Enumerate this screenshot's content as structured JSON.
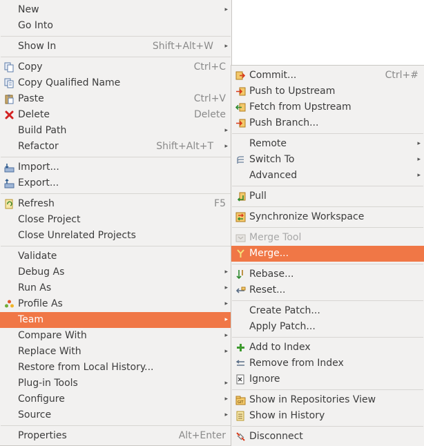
{
  "main_menu": {
    "items": [
      {
        "label": "New",
        "accel": "",
        "submenu": true,
        "icon": ""
      },
      {
        "label": "Go Into",
        "accel": "",
        "submenu": false,
        "icon": ""
      },
      {
        "label": "Show In",
        "accel": "Shift+Alt+W",
        "submenu": true,
        "icon": ""
      },
      {
        "label": "Copy",
        "accel": "Ctrl+C",
        "submenu": false,
        "icon": "copy-icon"
      },
      {
        "label": "Copy Qualified Name",
        "accel": "",
        "submenu": false,
        "icon": "copy-qualified-name-icon"
      },
      {
        "label": "Paste",
        "accel": "Ctrl+V",
        "submenu": false,
        "icon": "paste-icon"
      },
      {
        "label": "Delete",
        "accel": "Delete",
        "submenu": false,
        "icon": "delete-icon"
      },
      {
        "label": "Build Path",
        "accel": "",
        "submenu": true,
        "icon": ""
      },
      {
        "label": "Refactor",
        "accel": "Shift+Alt+T",
        "submenu": true,
        "icon": ""
      },
      {
        "label": "Import...",
        "accel": "",
        "submenu": false,
        "icon": "import-icon"
      },
      {
        "label": "Export...",
        "accel": "",
        "submenu": false,
        "icon": "export-icon"
      },
      {
        "label": "Refresh",
        "accel": "F5",
        "submenu": false,
        "icon": "refresh-icon"
      },
      {
        "label": "Close Project",
        "accel": "",
        "submenu": false,
        "icon": ""
      },
      {
        "label": "Close Unrelated Projects",
        "accel": "",
        "submenu": false,
        "icon": ""
      },
      {
        "label": "Validate",
        "accel": "",
        "submenu": false,
        "icon": ""
      },
      {
        "label": "Debug As",
        "accel": "",
        "submenu": true,
        "icon": ""
      },
      {
        "label": "Run As",
        "accel": "",
        "submenu": true,
        "icon": ""
      },
      {
        "label": "Profile As",
        "accel": "",
        "submenu": true,
        "icon": "profile-icon"
      },
      {
        "label": "Team",
        "accel": "",
        "submenu": true,
        "icon": ""
      },
      {
        "label": "Compare With",
        "accel": "",
        "submenu": true,
        "icon": ""
      },
      {
        "label": "Replace With",
        "accel": "",
        "submenu": true,
        "icon": ""
      },
      {
        "label": "Restore from Local History...",
        "accel": "",
        "submenu": false,
        "icon": ""
      },
      {
        "label": "Plug-in Tools",
        "accel": "",
        "submenu": true,
        "icon": ""
      },
      {
        "label": "Configure",
        "accel": "",
        "submenu": true,
        "icon": ""
      },
      {
        "label": "Source",
        "accel": "",
        "submenu": true,
        "icon": ""
      },
      {
        "label": "Properties",
        "accel": "Alt+Enter",
        "submenu": false,
        "icon": ""
      }
    ]
  },
  "team_menu": {
    "items": [
      {
        "label": "Commit...",
        "accel": "Ctrl+#",
        "submenu": false,
        "icon": "commit-icon"
      },
      {
        "label": "Push to Upstream",
        "accel": "",
        "submenu": false,
        "icon": "push-icon"
      },
      {
        "label": "Fetch from Upstream",
        "accel": "",
        "submenu": false,
        "icon": "fetch-icon"
      },
      {
        "label": "Push Branch...",
        "accel": "",
        "submenu": false,
        "icon": "push-branch-icon"
      },
      {
        "label": "Remote",
        "accel": "",
        "submenu": true,
        "icon": ""
      },
      {
        "label": "Switch To",
        "accel": "",
        "submenu": true,
        "icon": "switch-branch-icon"
      },
      {
        "label": "Advanced",
        "accel": "",
        "submenu": true,
        "icon": ""
      },
      {
        "label": "Pull",
        "accel": "",
        "submenu": false,
        "icon": "pull-icon"
      },
      {
        "label": "Synchronize Workspace",
        "accel": "",
        "submenu": false,
        "icon": "synchronize-icon"
      },
      {
        "label": "Merge Tool",
        "accel": "",
        "submenu": false,
        "icon": "merge-tool-icon"
      },
      {
        "label": "Merge...",
        "accel": "",
        "submenu": false,
        "icon": "merge-icon"
      },
      {
        "label": "Rebase...",
        "accel": "",
        "submenu": false,
        "icon": "rebase-icon"
      },
      {
        "label": "Reset...",
        "accel": "",
        "submenu": false,
        "icon": "reset-icon"
      },
      {
        "label": "Create Patch...",
        "accel": "",
        "submenu": false,
        "icon": ""
      },
      {
        "label": "Apply Patch...",
        "accel": "",
        "submenu": false,
        "icon": ""
      },
      {
        "label": "Add to Index",
        "accel": "",
        "submenu": false,
        "icon": "add-to-index-icon"
      },
      {
        "label": "Remove from Index",
        "accel": "",
        "submenu": false,
        "icon": "remove-from-index-icon"
      },
      {
        "label": "Ignore",
        "accel": "",
        "submenu": false,
        "icon": "ignore-icon"
      },
      {
        "label": "Show in Repositories View",
        "accel": "",
        "submenu": false,
        "icon": "repositories-view-icon"
      },
      {
        "label": "Show in History",
        "accel": "",
        "submenu": false,
        "icon": "history-icon"
      },
      {
        "label": "Disconnect",
        "accel": "",
        "submenu": false,
        "icon": "disconnect-icon"
      }
    ]
  },
  "colors": {
    "menu_background": "#f2f1f0",
    "highlight": "#f07746",
    "text": "#3c3c3c",
    "accelerator_text": "#8a8a8a",
    "disabled_text": "#a8a8a8"
  }
}
